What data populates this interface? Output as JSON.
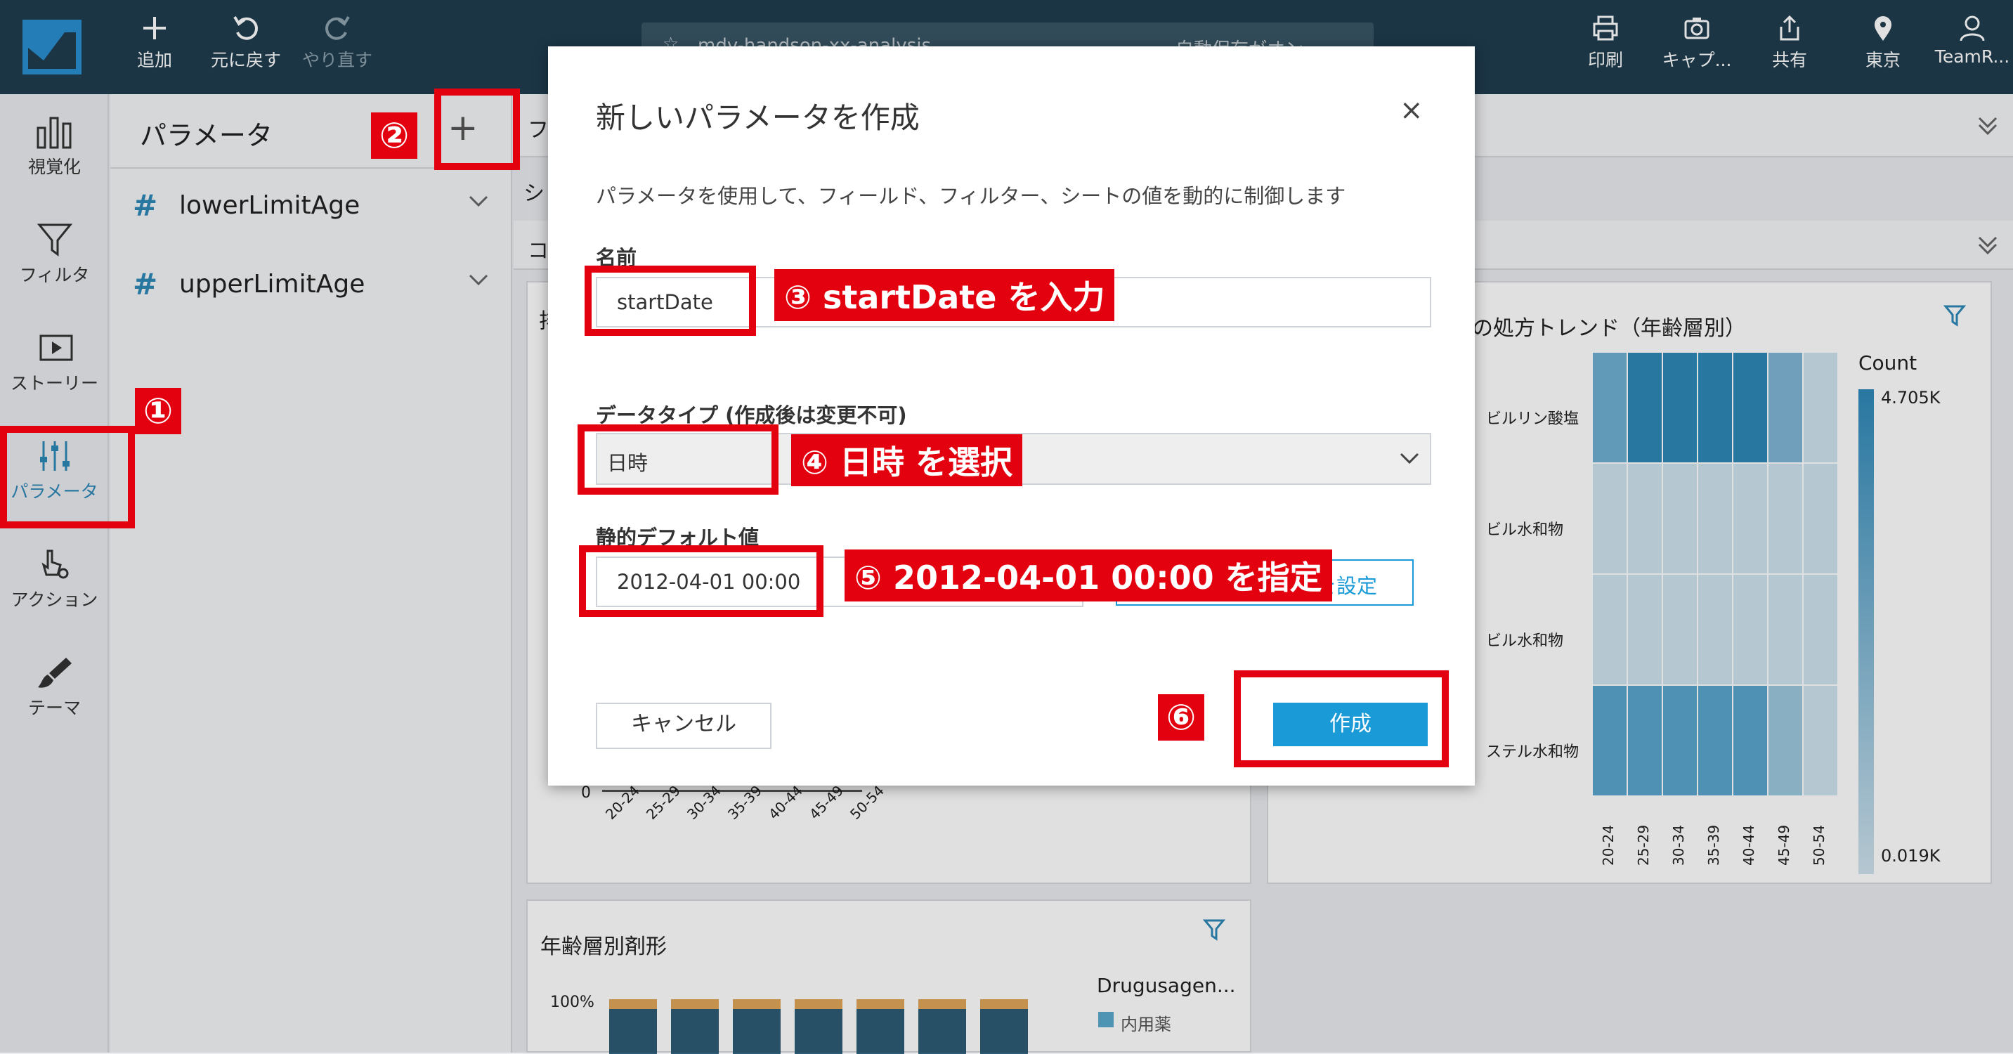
{
  "toolbar": {
    "add": "追加",
    "undo": "元に戻す",
    "redo": "やり直す",
    "title": "mdv-handson-xx-analysis",
    "autosave": "自動保存がオン ⌄",
    "print": "印刷",
    "capture": "キャプ...",
    "share": "共有",
    "region": "東京",
    "user": "TeamR..."
  },
  "rail": {
    "visualize": "視覚化",
    "filter": "フィルタ",
    "story": "ストーリー",
    "parameter": "パラメータ",
    "action": "アクション",
    "theme": "テーマ"
  },
  "panel": {
    "title": "パラメータ",
    "add_symbol": "+",
    "params": [
      {
        "name": "lowerLimitAge"
      },
      {
        "name": "upperLimitAge"
      }
    ]
  },
  "background": {
    "heatmap_title": "の処方トレンド（年齢層別）",
    "legend_title": "Count",
    "legend_max": "4.705K",
    "legend_min": "0.019K",
    "row_labels": [
      "ビルリン酸塩",
      "ビル水和物",
      "ビル水和物",
      "ステル水和物"
    ],
    "age_bins": [
      "20-24",
      "25-29",
      "30-34",
      "35-39",
      "40-44",
      "45-49",
      "50-54"
    ],
    "bar_title": "年齢層別剤形",
    "bar_axis_label": "100%",
    "bar_legend_title": "Drugusagen...",
    "bar_legend_item": "内用薬",
    "tab_char": "シ",
    "row_char": "コ",
    "tab_char2": "フ",
    "card_char": "排",
    "zero_tick": "0"
  },
  "dialog": {
    "title": "新しいパラメータを作成",
    "close": "×",
    "description": "パラメータを使用して、フィールド、フィルター、シートの値を動的に制御します",
    "name_label": "名前",
    "name_value": "startDate",
    "datatype_label": "データタイプ (作成後は変更不可)",
    "datatype_value": "日時",
    "default_label": "静的デフォルト値",
    "default_value": "2012-04-01 00:00",
    "set_value_button": "値を設定",
    "cancel": "キャンセル",
    "create": "作成"
  },
  "annotations": {
    "c1": "①",
    "c2": "②",
    "c3": "③ startDate を入力",
    "c4": "④ 日時 を選択",
    "c5": "⑤ 2012-04-01 00:00 を指定",
    "c6": "⑥"
  },
  "colors": {
    "topbar": "#1f3d4f",
    "accent": "#2e88b8",
    "primary_button": "#1a9ad6",
    "annotation_red": "#e3000f"
  }
}
